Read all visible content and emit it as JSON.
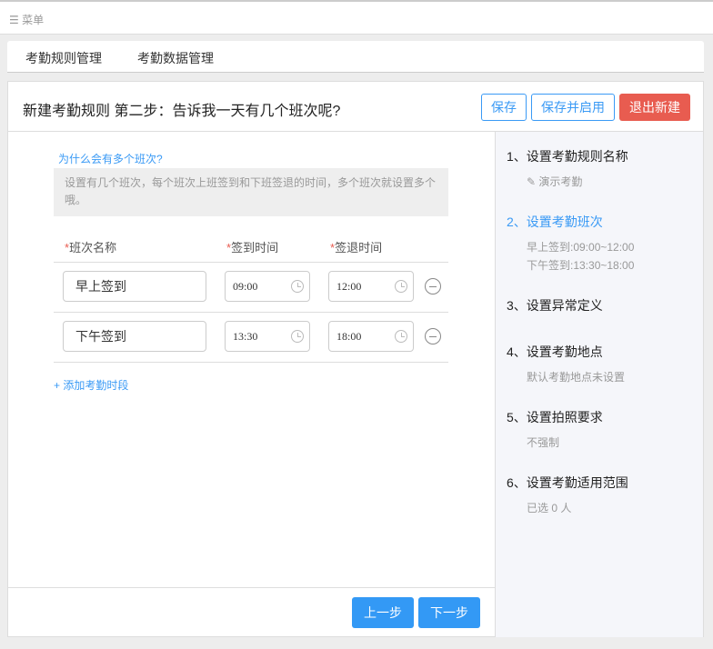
{
  "topbar": {
    "menu_icon": "hamburger-icon",
    "menu_label": "菜单"
  },
  "tabs": [
    "考勤规则管理",
    "考勤数据管理"
  ],
  "header": {
    "title": "新建考勤规则 第二步：告诉我一天有几个班次呢?",
    "save": "保存",
    "save_enable": "保存并启用",
    "exit": "退出新建"
  },
  "form": {
    "why_link": "为什么会有多个班次?",
    "tip": "设置有几个班次，每个班次上班签到和下班签退的时间，多个班次就设置多个哦。",
    "required_mark": "*",
    "columns": [
      "班次名称",
      "签到时间",
      "签退时间"
    ],
    "rows": [
      {
        "name": "早上签到",
        "in": "09:00",
        "out": "12:00"
      },
      {
        "name": "下午签到",
        "in": "13:30",
        "out": "18:00"
      }
    ],
    "add_link": "+ 添加考勤时段",
    "prev": "上一步",
    "next": "下一步"
  },
  "steps": [
    {
      "label": "1、设置考勤规则名称",
      "sub": [
        "演示考勤"
      ]
    },
    {
      "label": "2、设置考勤班次",
      "sub": [
        "早上签到:09:00~12:00",
        "下午签到:13:30~18:00"
      ]
    },
    {
      "label": "3、设置异常定义",
      "sub": []
    },
    {
      "label": "4、设置考勤地点",
      "sub": [
        "默认考勤地点未设置"
      ]
    },
    {
      "label": "5、设置拍照要求",
      "sub": [
        "不强制"
      ]
    },
    {
      "label": "6、设置考勤适用范围",
      "sub": [
        "已选 0 人"
      ]
    }
  ],
  "colors": {
    "accent": "#3a9af5",
    "danger": "#e85c50",
    "primary": "#3399f5"
  }
}
